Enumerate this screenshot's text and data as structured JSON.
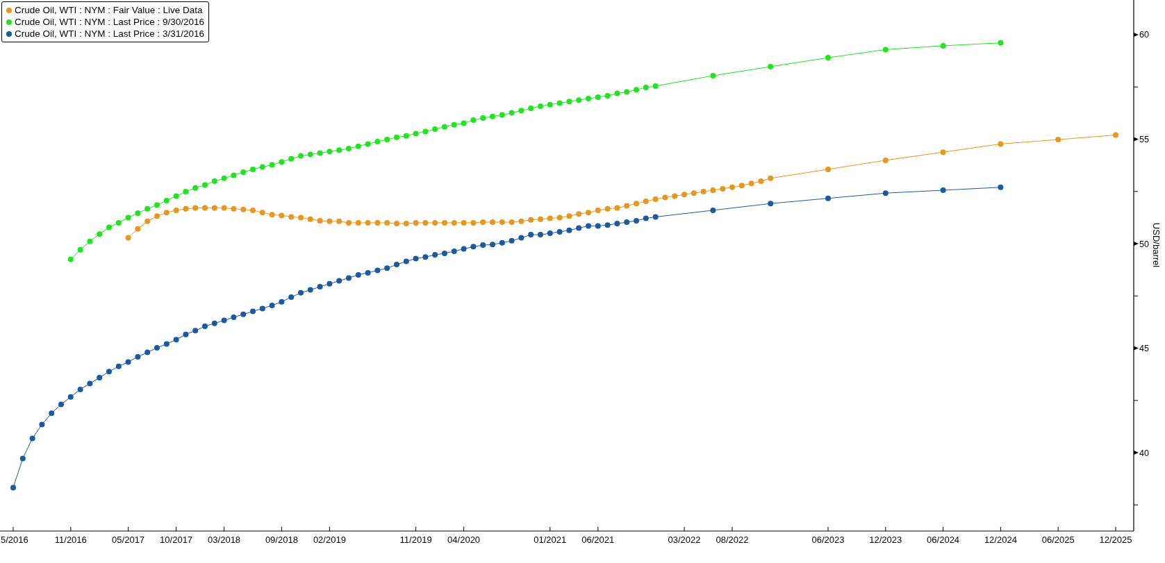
{
  "chart": {
    "chart_data": {
      "type": "line",
      "ylabel": "USD/barrel",
      "categories": [
        "5/2016",
        null,
        null,
        null,
        null,
        null,
        "11/2016",
        null,
        null,
        null,
        null,
        null,
        "05/2017",
        null,
        null,
        null,
        null,
        "10/2017",
        null,
        null,
        null,
        null,
        "03/2018",
        null,
        null,
        null,
        null,
        null,
        "09/2018",
        null,
        null,
        null,
        null,
        "02/2019",
        null,
        null,
        null,
        null,
        null,
        null,
        null,
        null,
        "11/2019",
        null,
        null,
        null,
        null,
        "04/2020",
        null,
        null,
        null,
        null,
        null,
        null,
        null,
        null,
        "01/2021",
        null,
        null,
        null,
        null,
        "06/2021",
        null,
        null,
        null,
        null,
        null,
        null,
        null,
        null,
        "03/2022",
        null,
        null,
        null,
        null,
        "08/2022",
        null,
        null,
        null,
        null,
        null,
        null,
        null,
        null,
        null,
        "06/2023",
        null,
        null,
        null,
        null,
        null,
        "12/2023",
        null,
        null,
        null,
        null,
        null,
        "06/2024",
        null,
        null,
        null,
        null,
        null,
        "12/2024",
        null,
        null,
        null,
        null,
        null,
        "06/2025",
        null,
        null,
        null,
        null,
        null,
        "12/2025"
      ],
      "ylim": [
        36.25,
        61.66
      ],
      "yticks": [
        40,
        45,
        50,
        55,
        60
      ],
      "series": [
        {
          "name": "Crude Oil, WTI : NYM : Fair Value : Live Data",
          "color": "#e8961e",
          "marker": "circle",
          "values": [
            null,
            null,
            null,
            null,
            null,
            null,
            null,
            null,
            null,
            null,
            null,
            null,
            50.28,
            50.71,
            51.07,
            51.32,
            51.49,
            51.6,
            51.67,
            51.71,
            51.71,
            51.71,
            51.71,
            51.67,
            51.64,
            51.6,
            51.49,
            51.39,
            51.35,
            51.28,
            51.25,
            51.17,
            51.1,
            51.07,
            51.07,
            51.0,
            51.0,
            51.0,
            51.0,
            51.0,
            50.96,
            50.96,
            51.0,
            51.0,
            51.0,
            51.0,
            51.0,
            51.0,
            51.0,
            51.03,
            51.03,
            51.03,
            51.03,
            51.07,
            51.14,
            51.17,
            51.21,
            51.25,
            51.32,
            51.42,
            51.49,
            51.6,
            51.67,
            51.71,
            51.81,
            51.92,
            52.03,
            52.13,
            52.21,
            52.28,
            52.35,
            52.42,
            52.49,
            52.56,
            52.63,
            52.7,
            52.78,
            52.88,
            52.99,
            53.13,
            null,
            null,
            null,
            null,
            null,
            53.56,
            null,
            null,
            null,
            null,
            null,
            53.99,
            null,
            null,
            null,
            null,
            null,
            54.38,
            null,
            null,
            null,
            null,
            null,
            54.77,
            null,
            null,
            null,
            null,
            null,
            54.98,
            null,
            null,
            null,
            null,
            null,
            55.2
          ]
        },
        {
          "name": "Crude Oil, WTI : NYM : Last Price : 9/30/2016",
          "color": "#1ee61e",
          "marker": "circle",
          "values": [
            null,
            null,
            null,
            null,
            null,
            null,
            49.25,
            49.71,
            50.11,
            50.46,
            50.78,
            51.0,
            51.25,
            51.46,
            51.67,
            51.85,
            52.06,
            52.28,
            52.49,
            52.67,
            52.81,
            52.99,
            53.13,
            53.27,
            53.42,
            53.56,
            53.67,
            53.77,
            53.91,
            54.06,
            54.2,
            54.27,
            54.34,
            54.41,
            54.48,
            54.55,
            54.66,
            54.77,
            54.88,
            54.98,
            55.09,
            55.16,
            55.27,
            55.37,
            55.48,
            55.59,
            55.69,
            55.76,
            55.91,
            56.01,
            56.09,
            56.16,
            56.26,
            56.37,
            56.48,
            56.58,
            56.65,
            56.73,
            56.8,
            56.87,
            56.94,
            57.01,
            57.08,
            57.19,
            57.26,
            57.37,
            57.47,
            57.54,
            null,
            null,
            null,
            null,
            null,
            58.04,
            null,
            null,
            null,
            null,
            null,
            58.47,
            null,
            null,
            null,
            null,
            null,
            58.9,
            null,
            null,
            null,
            null,
            null,
            59.29,
            null,
            null,
            null,
            null,
            null,
            59.47,
            null,
            null,
            null,
            null,
            null,
            59.61,
            null,
            null,
            null,
            null,
            null,
            null,
            null,
            null,
            null,
            null,
            null,
            null
          ]
        },
        {
          "name": "Crude Oil, WTI : NYM : Last Price : 3/31/2016",
          "color": "#1a5aa0",
          "marker": "circle",
          "values": [
            38.33,
            39.72,
            40.68,
            41.35,
            41.89,
            42.31,
            42.67,
            43.03,
            43.31,
            43.59,
            43.88,
            44.13,
            44.34,
            44.59,
            44.8,
            45.02,
            45.2,
            45.41,
            45.66,
            45.84,
            46.05,
            46.19,
            46.33,
            46.48,
            46.62,
            46.76,
            46.9,
            47.05,
            47.22,
            47.44,
            47.65,
            47.79,
            47.94,
            48.08,
            48.22,
            48.36,
            48.51,
            48.61,
            48.72,
            48.83,
            49.0,
            49.15,
            49.29,
            49.36,
            49.47,
            49.54,
            49.64,
            49.75,
            49.86,
            49.93,
            49.96,
            50.04,
            50.14,
            50.28,
            50.43,
            50.43,
            50.5,
            50.57,
            50.64,
            50.75,
            50.85,
            50.85,
            50.89,
            50.96,
            51.03,
            51.1,
            51.21,
            51.28,
            null,
            null,
            null,
            null,
            null,
            51.6,
            null,
            null,
            null,
            null,
            null,
            51.92,
            null,
            null,
            null,
            null,
            null,
            52.17,
            null,
            null,
            null,
            null,
            null,
            52.42,
            null,
            null,
            null,
            null,
            null,
            52.56,
            null,
            null,
            null,
            null,
            null,
            52.7,
            null,
            null,
            null,
            null,
            null,
            null,
            null,
            null,
            null,
            null,
            null,
            null
          ]
        }
      ]
    }
  }
}
